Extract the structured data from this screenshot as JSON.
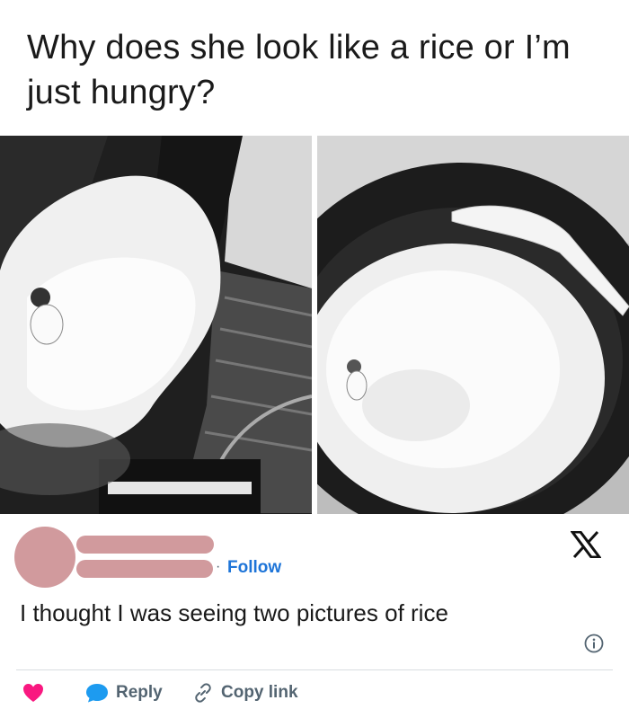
{
  "caption": "Why does she look like a rice or I’m just hungry?",
  "tweet": {
    "follow_separator": "·",
    "follow_label": "Follow",
    "text": "I thought I was seeing two pictures of rice",
    "actions": {
      "reply_label": "Reply",
      "copy_link_label": "Copy link"
    }
  },
  "colors": {
    "redaction": "#d19a9d",
    "follow_link": "#1d74d8",
    "like_heart": "#f91880",
    "reply_bubble": "#1d9bf0",
    "muted_text": "#536471"
  },
  "icons": {
    "platform_logo": "x-logo-icon",
    "info": "info-icon",
    "like": "heart-icon",
    "reply": "speech-bubble-icon",
    "copy": "link-icon"
  }
}
